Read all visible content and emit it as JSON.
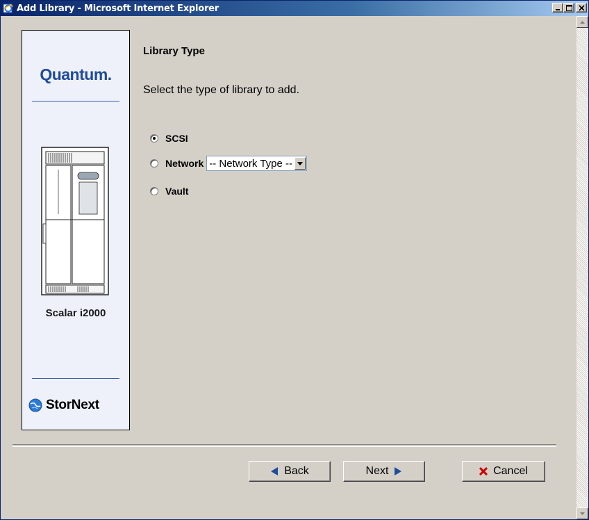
{
  "window": {
    "title": "Add Library - Microsoft Internet Explorer",
    "controls": {
      "minimize": "minimize",
      "maximize": "maximize",
      "close": "close"
    }
  },
  "brand": {
    "logo_text": "Quantum.",
    "device_name": "Scalar i2000",
    "footer_logo_text": "StorNext"
  },
  "main": {
    "heading": "Library Type",
    "instruction": "Select the type of library to add.",
    "options": [
      {
        "label": "SCSI",
        "selected": true
      },
      {
        "label": "Network",
        "selected": false
      },
      {
        "label": "Vault",
        "selected": false
      }
    ],
    "network_type_select": {
      "value": "-- Network Type --"
    }
  },
  "buttons": {
    "back": "Back",
    "next": "Next",
    "cancel": "Cancel"
  },
  "colors": {
    "titlebar_start": "#0a246a",
    "titlebar_end": "#a6caf0",
    "brand_blue": "#1f4b9a",
    "arrow_blue": "#1f4b9a",
    "cancel_red": "#cc0000",
    "panel_bg": "#eef1fa",
    "dialog_bg": "#d4d0c8"
  },
  "icons": {
    "app": "ie-icon",
    "back": "left-arrow-icon",
    "next": "right-arrow-icon",
    "cancel": "red-x-icon",
    "globe": "globe-icon"
  }
}
